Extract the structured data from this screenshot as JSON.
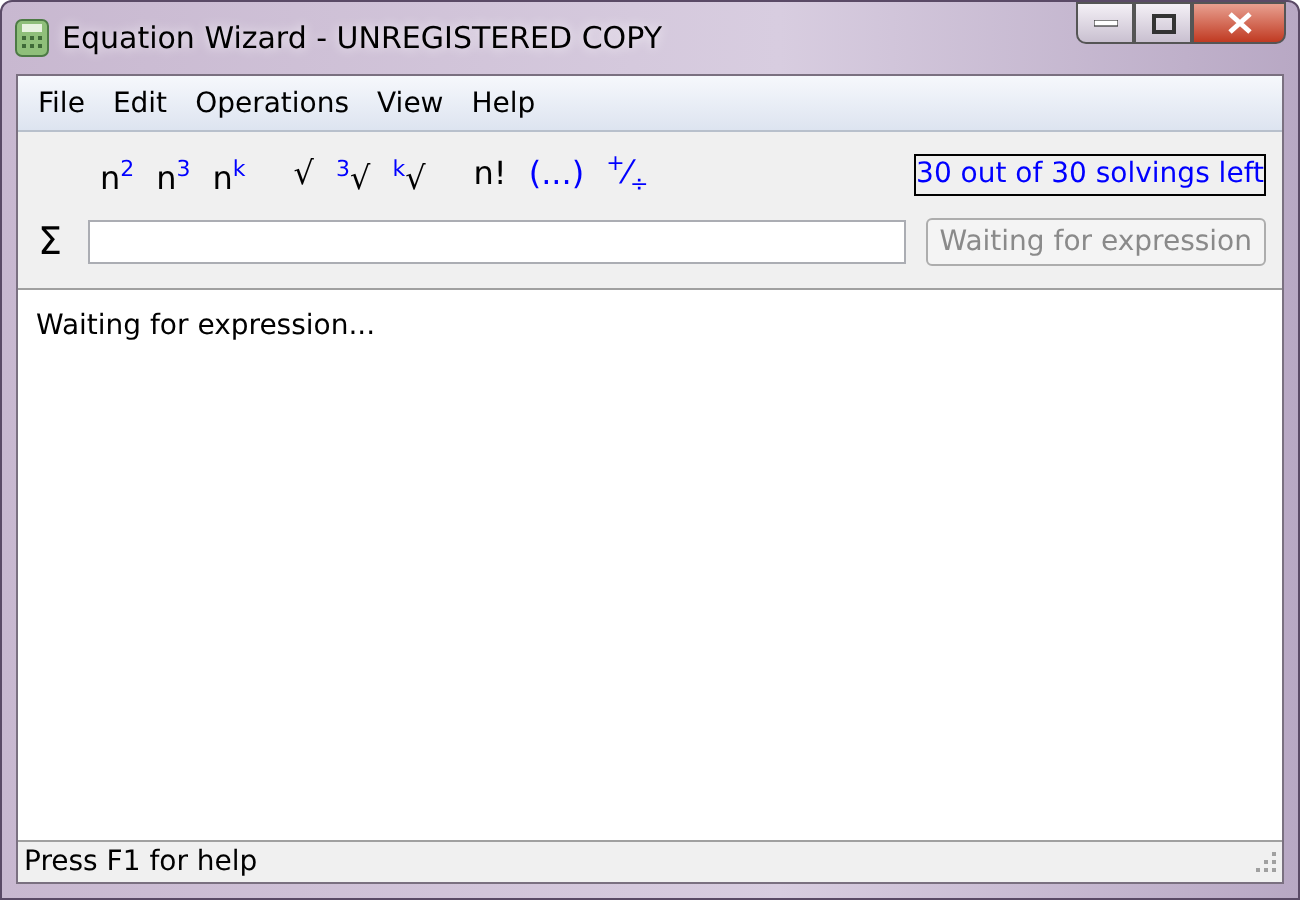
{
  "window": {
    "title": "Equation Wizard - UNREGISTERED COPY"
  },
  "menu": [
    "File",
    "Edit",
    "Operations",
    "View",
    "Help"
  ],
  "tools": [
    {
      "label": "n$^{2}$",
      "color": "#000000"
    },
    {
      "label": "n$^{3}$",
      "color": "#000000"
    },
    {
      "label": "n$^{k}$",
      "color": "#000000"
    },
    {
      "label": "√",
      "color": "#000000"
    },
    {
      "label": "$^{3}$√",
      "color": "#000000"
    },
    {
      "label": "$^{k}$√",
      "color": "#000000"
    },
    {
      "label": "n!",
      "color": "#000000"
    },
    {
      "label": "(...)",
      "color": "#0000ff"
    },
    {
      "label": "$^{+}$⁄$_{÷}$",
      "color": "#0000ff"
    }
  ],
  "solvings_left": "30 out of 30 solvings left",
  "sigma": "Σ",
  "solve_button": {
    "label": "Waiting for expression",
    "disabled": true
  },
  "output": "Waiting for expression...",
  "status_bar": "Press F1 for help"
}
